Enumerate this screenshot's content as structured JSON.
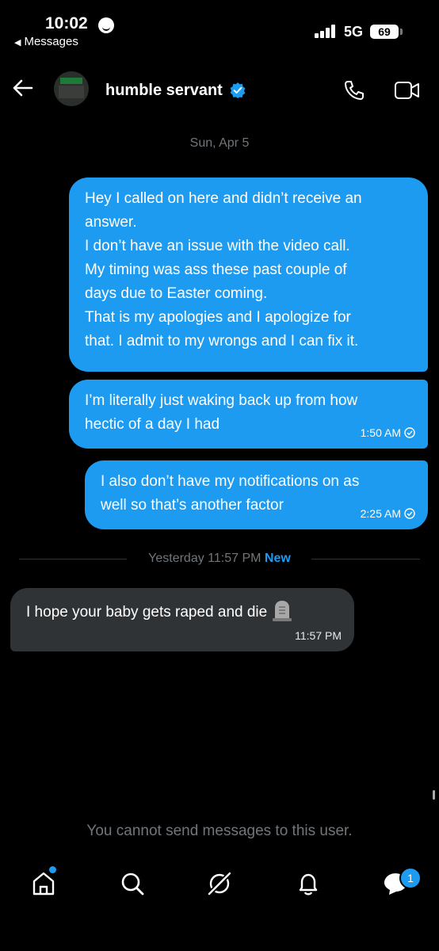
{
  "status_bar": {
    "time": "10:02",
    "back_app": "Messages",
    "network": "5G",
    "battery": "69"
  },
  "header": {
    "username": "humble servant",
    "verified": true,
    "icons": [
      "back-arrow-icon",
      "phone-icon",
      "video-icon"
    ]
  },
  "conversation": {
    "date_label": "Sun, Apr 5",
    "sent_messages": [
      {
        "lines": [
          "Hey I called on here and didn’t receive an",
          "answer.",
          "I don’t have an issue with the video call.",
          "My timing was ass these past couple of",
          "days due to Easter coming.",
          "That is my apologies and I apologize for",
          "that. I admit to my wrongs and I can fix it."
        ]
      },
      {
        "lines": [
          "I’m literally just waking back up from how",
          "hectic of a day I had"
        ],
        "time": "1:50 AM"
      },
      {
        "lines": [
          "I also don’t have my notifications on as",
          "well so that’s another factor"
        ],
        "time": "2:25 AM"
      }
    ],
    "new_divider": {
      "label": "Yesterday 11:57 PM",
      "new": "New"
    },
    "received_message": {
      "text": "I hope your baby gets raped and die",
      "emoji": "headstone",
      "time": "11:57 PM"
    },
    "cannot_send": "You cannot send messages to this user."
  },
  "tab_bar": {
    "items": [
      "home-icon",
      "search-icon",
      "grok-icon",
      "notifications-icon",
      "messages-icon"
    ],
    "messages_badge": "1"
  },
  "colors": {
    "accent": "#1d9bf0",
    "received_bubble": "#2f3336",
    "muted_text": "#71767b"
  }
}
